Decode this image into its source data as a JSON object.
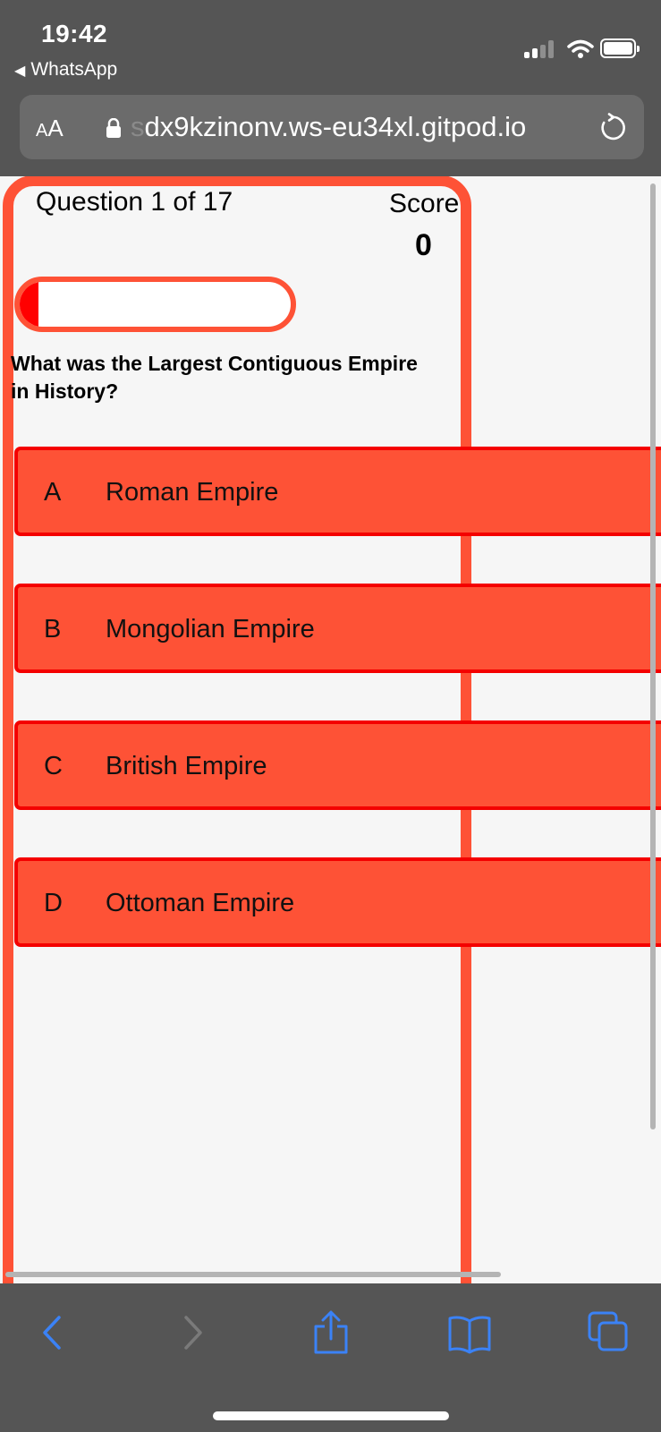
{
  "status_bar": {
    "time": "19:42",
    "back_app": "WhatsApp"
  },
  "browser": {
    "text_size_small": "A",
    "text_size_large": "A",
    "url_faded": "s",
    "url": "dx9kzinonv.ws-eu34xl.gitpod.io",
    "icons": [
      "lock-icon",
      "reload-icon"
    ]
  },
  "quiz": {
    "question_counter": "Question 1 of 17",
    "score_label": "Score",
    "score_value": "0",
    "progress_fraction": 0.07,
    "question": "What was the Largest Contiguous Empire in History?",
    "answers": [
      {
        "prefix": "A",
        "text": "Roman Empire"
      },
      {
        "prefix": "B",
        "text": "Mongolian Empire"
      },
      {
        "prefix": "C",
        "text": "British Empire"
      },
      {
        "prefix": "D",
        "text": "Ottoman Empire"
      }
    ]
  },
  "toolbar": {
    "icons": [
      "back-arrow-icon",
      "forward-arrow-icon",
      "share-icon",
      "bookmarks-icon",
      "tabs-icon"
    ]
  },
  "colors": {
    "accent": "#fe5236",
    "answer_border": "#f40000",
    "progress_fill": "#ff0000",
    "chrome": "#555555",
    "ios_blue": "#3b82f6"
  }
}
